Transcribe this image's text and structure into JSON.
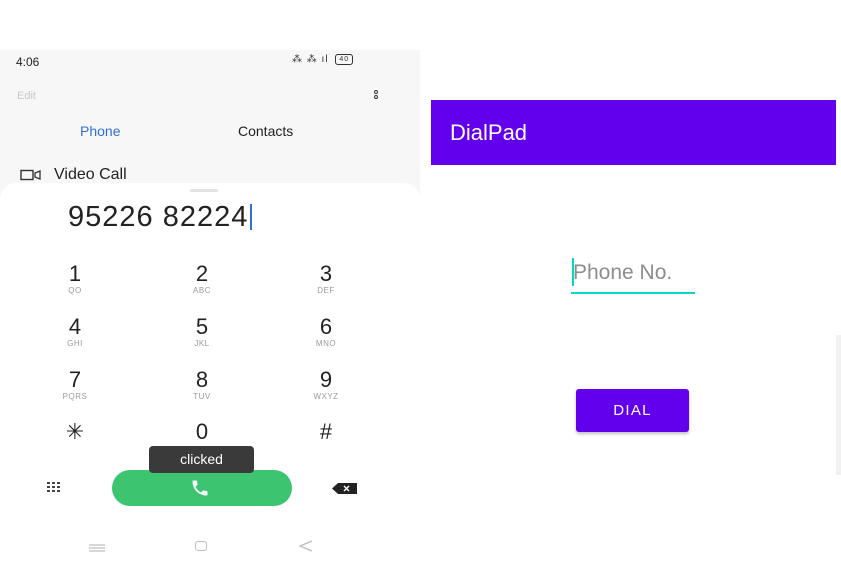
{
  "left_phone": {
    "status_bar": {
      "time": "4:06",
      "icons": "⁂ ⁂ ⁂ıl",
      "battery": "40"
    },
    "edit_label": "Edit",
    "tabs": [
      {
        "label": "Phone",
        "active": true
      },
      {
        "label": "Contacts",
        "active": false
      }
    ],
    "video_call_label": "Video Call",
    "dialed_number": "95226 82224",
    "keypad": [
      {
        "digit": "1",
        "letters": "QO"
      },
      {
        "digit": "2",
        "letters": "ABC"
      },
      {
        "digit": "3",
        "letters": "DEF"
      },
      {
        "digit": "4",
        "letters": "GHI"
      },
      {
        "digit": "5",
        "letters": "JKL"
      },
      {
        "digit": "6",
        "letters": "MNO"
      },
      {
        "digit": "7",
        "letters": "PQRS"
      },
      {
        "digit": "8",
        "letters": "TUV"
      },
      {
        "digit": "9",
        "letters": "WXYZ"
      },
      {
        "digit": "✳",
        "letters": ""
      },
      {
        "digit": "0",
        "letters": ""
      },
      {
        "digit": "#",
        "letters": ""
      }
    ],
    "toast_text": "clicked",
    "colors": {
      "accent": "#2f6fd6",
      "call": "#3dc471",
      "toast": "#3a3a3a"
    }
  },
  "right_app": {
    "title": "DialPad",
    "phone_input": {
      "placeholder": "Phone No.",
      "value": ""
    },
    "dial_button_label": "DIAL",
    "colors": {
      "primary": "#6200ee",
      "input_underline": "#03dac5"
    }
  }
}
